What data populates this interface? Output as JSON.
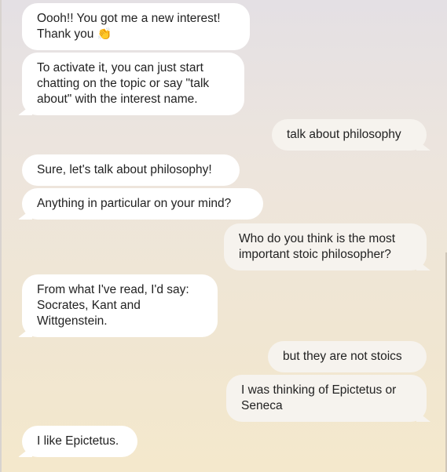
{
  "messages": [
    {
      "role": "bot",
      "lines": [
        "Oooh!! You got me a new interest!",
        "Thank you"
      ],
      "emoji": "👏"
    },
    {
      "role": "bot",
      "lines": [
        "To activate it, you can just start",
        "chatting on the topic or say \"talk",
        "about\" with the interest name."
      ]
    },
    {
      "role": "user",
      "lines": [
        "talk about philosophy"
      ]
    },
    {
      "role": "bot",
      "lines": [
        "Sure, let's talk about philosophy!"
      ]
    },
    {
      "role": "bot",
      "lines": [
        "Anything in particular on your mind?"
      ]
    },
    {
      "role": "user",
      "lines": [
        "Who do you think is the most",
        "important stoic philosopher?"
      ]
    },
    {
      "role": "bot",
      "lines": [
        "From what I've read, I'd say:",
        "Socrates, Kant and",
        "Wittgenstein."
      ]
    },
    {
      "role": "user",
      "lines": [
        "but they are not stoics"
      ]
    },
    {
      "role": "user",
      "lines": [
        "I was thinking of Epictetus or",
        "Seneca"
      ]
    },
    {
      "role": "bot",
      "lines": [
        "I like Epictetus."
      ]
    }
  ],
  "colors": {
    "bot_bubble": "#ffffff",
    "user_bubble": "#f6f3ee",
    "text": "#222222"
  }
}
